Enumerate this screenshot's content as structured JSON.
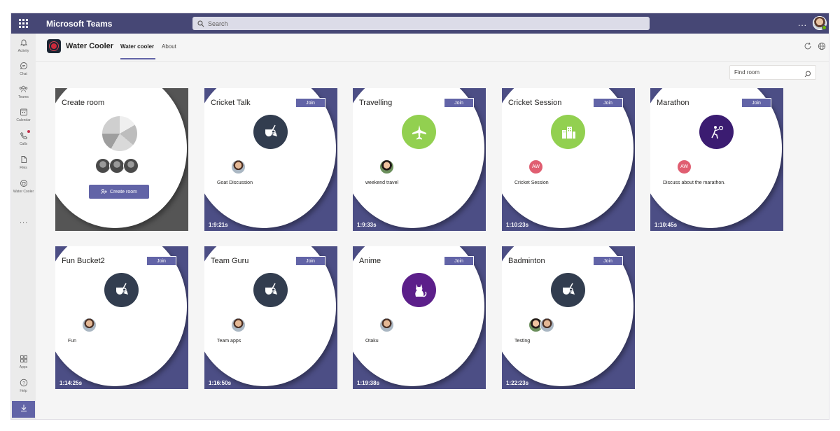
{
  "titlebar": {
    "app_title": "Microsoft Teams",
    "search_placeholder": "Search",
    "more": "...",
    "icons": [
      "app-launcher-icon",
      "search-icon",
      "user-avatar"
    ]
  },
  "rail": {
    "items": [
      {
        "label": "Activity",
        "icon": "bell-icon"
      },
      {
        "label": "Chat",
        "icon": "chat-icon"
      },
      {
        "label": "Teams",
        "icon": "teams-icon"
      },
      {
        "label": "Calendar",
        "icon": "calendar-icon"
      },
      {
        "label": "Calls",
        "icon": "phone-icon"
      },
      {
        "label": "Files",
        "icon": "file-icon"
      },
      {
        "label": "Water Cooler",
        "icon": "water-cooler-icon"
      }
    ],
    "more": "...",
    "bottom": [
      {
        "label": "Apps",
        "icon": "apps-icon"
      },
      {
        "label": "Help",
        "icon": "help-icon"
      }
    ],
    "download_icon": "download-icon"
  },
  "header": {
    "app_name": "Water Cooler",
    "tabs": [
      {
        "label": "Water cooler",
        "active": true
      },
      {
        "label": "About",
        "active": false
      }
    ],
    "icons": [
      "refresh-icon",
      "globe-icon"
    ]
  },
  "find_room": {
    "placeholder": "Find room"
  },
  "create_card": {
    "title": "Create room",
    "button_label": "Create room"
  },
  "rooms": [
    {
      "name": "Cricket Talk",
      "join": "Join",
      "description": "Goat Discussion",
      "timer": "1:9:21s",
      "icon": "tea-icon",
      "color": "#323d4f",
      "members": [
        "photo"
      ]
    },
    {
      "name": "Travelling",
      "join": "Join",
      "description": "weekend travel",
      "timer": "1:9:33s",
      "icon": "airplane-icon",
      "color": "#92d050",
      "members": [
        "photo2"
      ]
    },
    {
      "name": "Cricket Session",
      "join": "Join",
      "description": "Cricket Session",
      "timer": "1:10:23s",
      "icon": "city-icon",
      "color": "#92d050",
      "members": [
        "AW"
      ]
    },
    {
      "name": "Marathon",
      "join": "Join",
      "description": "Discuss about the marathon.",
      "timer": "1:10:45s",
      "icon": "tennis-icon",
      "color": "#3b1c71",
      "members": [
        "AW"
      ]
    },
    {
      "name": "Fun Bucket2",
      "join": "Join",
      "description": "Fun",
      "timer": "1:14:25s",
      "icon": "tea-icon",
      "color": "#323d4f",
      "members": [
        "photo"
      ]
    },
    {
      "name": "Team Guru",
      "join": "Join",
      "description": "Team apps",
      "timer": "1:16:50s",
      "icon": "tea-icon",
      "color": "#323d4f",
      "members": [
        "photo"
      ]
    },
    {
      "name": "Anime",
      "join": "Join",
      "description": "Otaku",
      "timer": "1:19:38s",
      "icon": "cat-icon",
      "color": "#5c1f8a",
      "members": [
        "photo"
      ]
    },
    {
      "name": "Badminton",
      "join": "Join",
      "description": "Testing",
      "timer": "1:22:23s",
      "icon": "tea-icon",
      "color": "#323d4f",
      "members": [
        "photo2",
        "photo"
      ]
    }
  ],
  "colors": {
    "accent": "#6264a7",
    "titlebar": "#464775",
    "card_back": "#4c4e85"
  }
}
